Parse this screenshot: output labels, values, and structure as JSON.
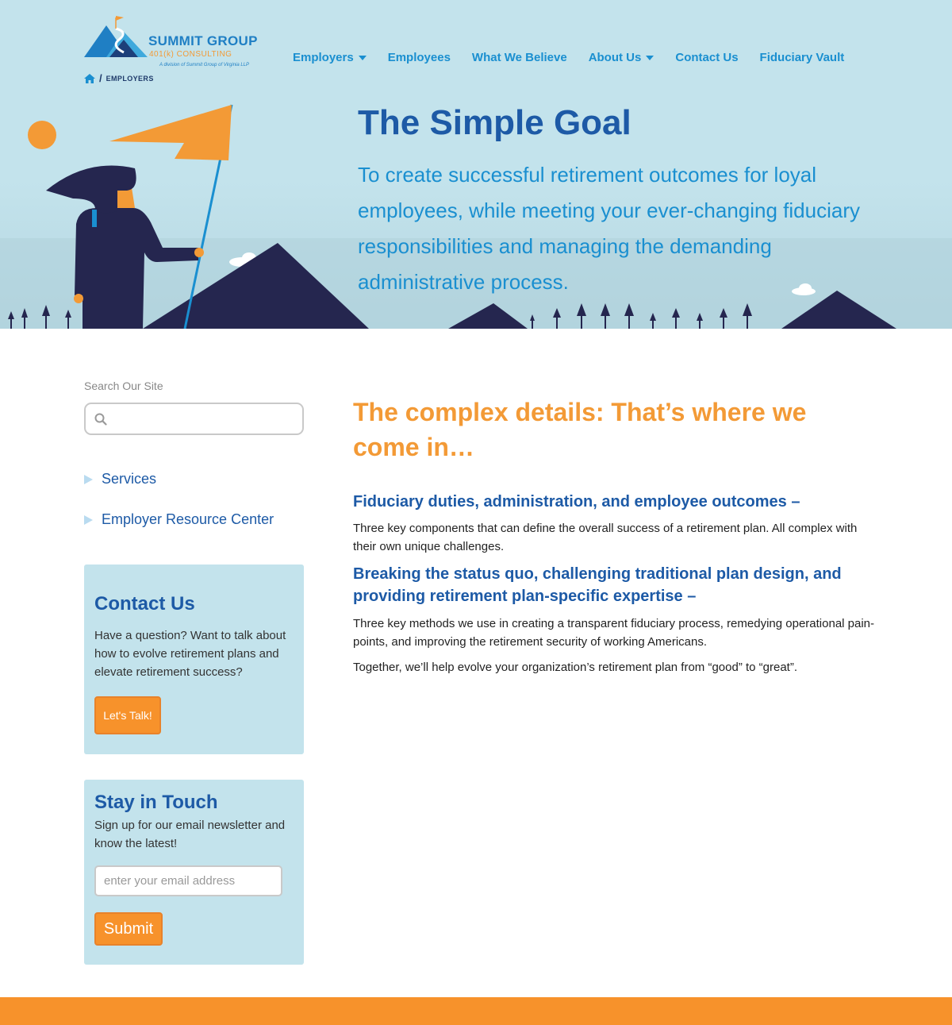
{
  "logo": {
    "title": "SUMMIT GROUP",
    "subtitle": "401(k) CONSULTING",
    "division": "A division of Summit Group of Virginia LLP"
  },
  "breadcrumb": {
    "separator": "/",
    "current": "EMPLOYERS"
  },
  "nav": {
    "items": [
      {
        "label": "Employers",
        "has_dropdown": true
      },
      {
        "label": "Employees",
        "has_dropdown": false
      },
      {
        "label": "What We Believe",
        "has_dropdown": false
      },
      {
        "label": "About Us",
        "has_dropdown": true
      },
      {
        "label": "Contact Us",
        "has_dropdown": false
      },
      {
        "label": "Fiduciary Vault",
        "has_dropdown": false
      }
    ]
  },
  "hero": {
    "title": "The Simple Goal",
    "text": "To create successful retirement outcomes for loyal employees, while meeting your ever-changing fiduciary responsibilities and managing the demanding administrative process."
  },
  "sidebar": {
    "search_label": "Search Our Site",
    "search_value": "",
    "links": [
      {
        "label": "Services"
      },
      {
        "label": "Employer Resource Center"
      }
    ],
    "contact_card": {
      "title": "Contact Us",
      "text": "Have a question? Want to talk about how to evolve retirement plans and elevate retirement success?",
      "button": "Let's Talk!"
    },
    "newsletter_card": {
      "title": "Stay in Touch",
      "text": "Sign up for our email newsletter and know the latest!",
      "email_placeholder": "enter your email address",
      "button": "Submit"
    }
  },
  "main": {
    "heading": "The complex details: That’s where we come in…",
    "section1_heading": "Fiduciary duties, administration, and employee outcomes –",
    "section1_text": "Three key components that can define the overall success of a retirement plan. All complex with their own unique challenges.",
    "section2_heading": "Breaking the status quo, challenging traditional plan design, and providing retirement plan-specific expertise –",
    "section2_text": "Three key methods we use in creating a transparent fiduciary process, remedying operational pain-points, and improving the retirement security of working Americans.",
    "closing_text": "Together, we’ll help evolve your organization’s retirement plan from “good” to “great”."
  },
  "colors": {
    "sky": "#c3e3ec",
    "navy": "#1d5aa6",
    "accent_blue": "#1a8fd0",
    "orange": "#f7922b",
    "mountain": "#25264f"
  },
  "icons": {
    "home": "home-icon",
    "search": "search-icon",
    "nav_caret": "caret-down-icon",
    "list_bullet": "triangle-right-icon"
  }
}
